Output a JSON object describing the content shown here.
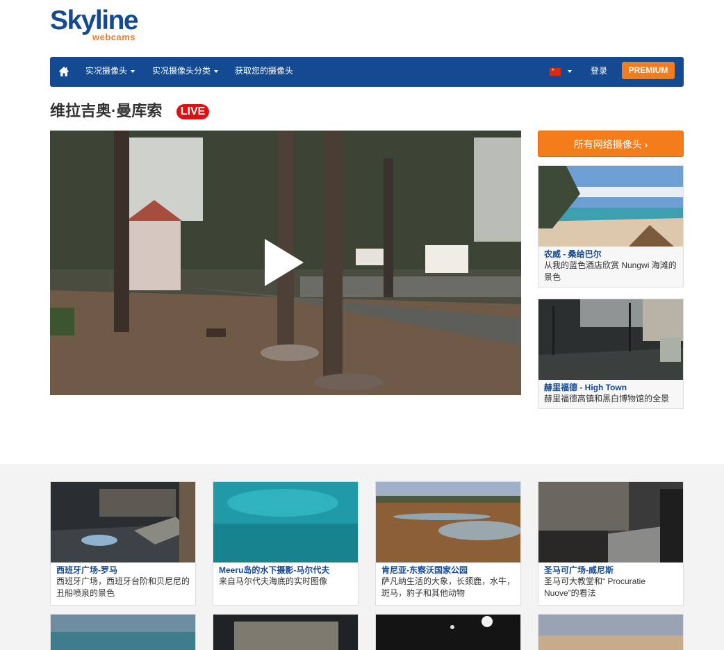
{
  "brand": {
    "name": "Skyline",
    "sub": "webcams"
  },
  "nav": {
    "items": [
      {
        "label": "实况摄像头",
        "dropdown": true
      },
      {
        "label": "实况摄像头分类",
        "dropdown": true
      },
      {
        "label": "获取您的摄像头",
        "dropdown": false
      }
    ],
    "login": "登录",
    "premium": "PREMIUM",
    "language_icon": "china-flag-icon",
    "home_icon": "home-icon"
  },
  "page": {
    "title": "维拉吉奥·曼库索",
    "live_badge": "LIVE"
  },
  "sidebar": {
    "all_cams_button": "所有网络摄像头",
    "cards": [
      {
        "title": "农威 - 桑给巴尔",
        "desc": "从我的蓝色酒店欣赏 Nungwi 海滩的景色"
      },
      {
        "title": "赫里福德 - High Town",
        "desc": "赫里福德高镇和黑白博物馆的全景"
      }
    ]
  },
  "grid": [
    {
      "title": "西班牙广场-罗马",
      "desc": "西班牙广场，西班牙台阶和贝尼尼的丑船喷泉的景色"
    },
    {
      "title": "Meeru岛的水下摄影-马尔代夫",
      "desc": "来自马尔代夫海底的实时图像"
    },
    {
      "title": "肯尼亚-东察沃国家公园",
      "desc": "萨凡纳生活的大象，长颈鹿，水牛，斑马，豹子和其他动物"
    },
    {
      "title": "圣马可广场-威尼斯",
      "desc": "圣马可大教堂和“ Procuratie Nuove”的看法"
    }
  ],
  "colors": {
    "brand_blue": "#134a91",
    "accent_orange": "#f47c1a",
    "live_red": "#e01010"
  }
}
